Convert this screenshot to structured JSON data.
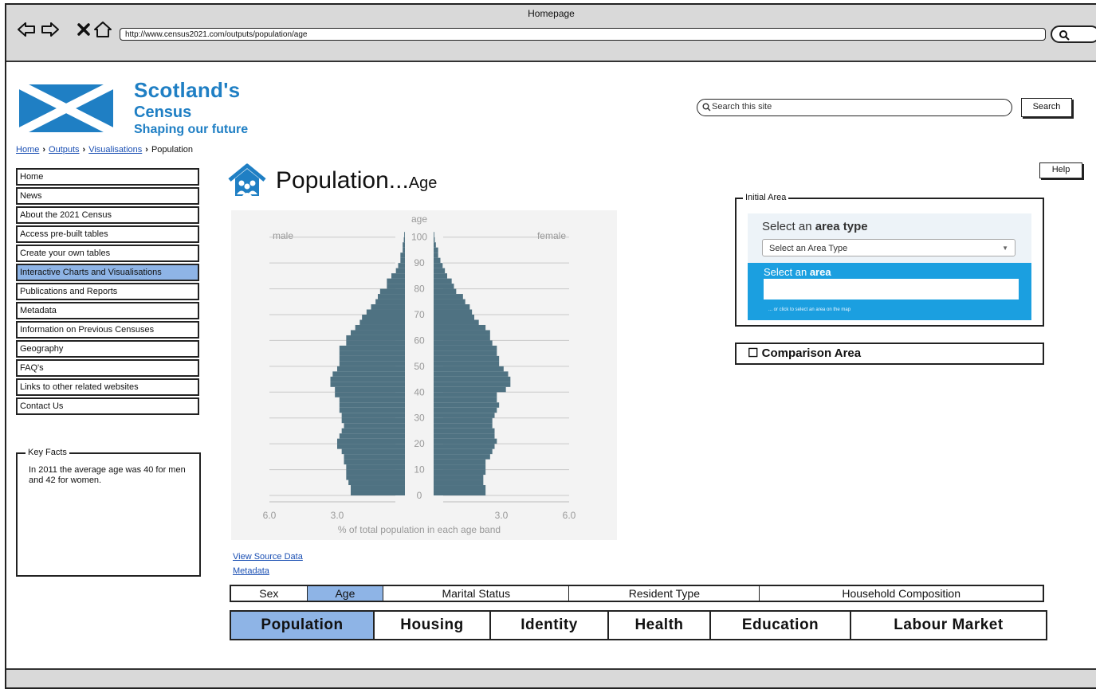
{
  "window": {
    "title": "Homepage",
    "url": "http://www.census2021.com/outputs/population/age"
  },
  "logo": {
    "line1": "Scotland's",
    "line2": "Census",
    "line3": "Shaping our future"
  },
  "breadcrumb": {
    "items": [
      "Home",
      "Outputs",
      "Visualisations"
    ],
    "current": "Population"
  },
  "search": {
    "placeholder": "Search this site",
    "button_label": "Search"
  },
  "help_label": "Help",
  "sidebar": {
    "items": [
      {
        "label": "Home"
      },
      {
        "label": "News"
      },
      {
        "label": "About the 2021 Census"
      },
      {
        "label": "Access pre-built tables"
      },
      {
        "label": "Create your own tables"
      },
      {
        "label": "Interactive Charts and Visualisations",
        "active": true
      },
      {
        "label": "Publications and Reports"
      },
      {
        "label": "Metadata"
      },
      {
        "label": "Information on Previous Censuses"
      },
      {
        "label": "Geography"
      },
      {
        "label": "FAQ's"
      },
      {
        "label": "Links to other related websites"
      },
      {
        "label": "Contact Us"
      }
    ]
  },
  "key_facts": {
    "title": "Key Facts",
    "text": "In 2011 the average age was 40 for men and 42 for women."
  },
  "page": {
    "title": "Population...",
    "subtitle": "Age"
  },
  "chart_data": {
    "type": "bar",
    "orientation": "horizontal-pyramid",
    "title": "",
    "ylabel": "age",
    "xlabel": "% of total population in each age band",
    "left_label": "male",
    "right_label": "female",
    "y_ticks": [
      0,
      10,
      20,
      30,
      40,
      50,
      60,
      70,
      80,
      90,
      100
    ],
    "x_ticks_left": [
      "6.0",
      "3.0"
    ],
    "x_ticks_right": [
      "3.0",
      "6.0"
    ],
    "xlim": [
      0,
      6
    ],
    "ylim": [
      0,
      103
    ],
    "band_width_years": 2,
    "series": [
      {
        "name": "male",
        "color": "#4f7282",
        "values": [
          2.4,
          2.4,
          2.5,
          2.6,
          2.6,
          2.6,
          2.7,
          2.7,
          2.8,
          3.0,
          3.0,
          2.9,
          2.8,
          2.7,
          2.8,
          2.8,
          2.9,
          2.9,
          2.9,
          3.1,
          3.1,
          3.3,
          3.3,
          3.2,
          3.0,
          2.9,
          2.9,
          2.9,
          2.9,
          2.6,
          2.6,
          2.4,
          2.2,
          2.0,
          1.9,
          1.7,
          1.5,
          1.3,
          1.2,
          1.1,
          0.8,
          0.8,
          0.6,
          0.4,
          0.3,
          0.2,
          0.2,
          0.1,
          0.1,
          0.05,
          0.03
        ]
      },
      {
        "name": "female",
        "color": "#4f7282",
        "values": [
          2.3,
          2.3,
          2.2,
          2.2,
          2.3,
          2.3,
          2.3,
          2.5,
          2.6,
          2.7,
          2.8,
          2.7,
          2.7,
          2.6,
          2.6,
          2.7,
          2.8,
          2.9,
          2.8,
          2.8,
          3.2,
          3.4,
          3.4,
          3.3,
          3.1,
          2.9,
          2.9,
          2.8,
          2.8,
          2.6,
          2.5,
          2.5,
          2.3,
          2.0,
          1.8,
          1.7,
          1.6,
          1.4,
          1.3,
          1.0,
          0.9,
          0.8,
          0.6,
          0.5,
          0.4,
          0.3,
          0.2,
          0.2,
          0.1,
          0.05,
          0.03
        ]
      }
    ],
    "grid": true
  },
  "links": {
    "view_source": "View Source Data",
    "metadata": "Metadata"
  },
  "initial_area": {
    "legend": "Initial Area",
    "type_label_pre": "Select an ",
    "type_label_bold": "area type",
    "type_select_value": "Select an Area Type",
    "area_label_pre": "Select an ",
    "area_label_bold": "area",
    "map_hint": "... or click to select an area on the map"
  },
  "comparison": {
    "label": "Comparison Area"
  },
  "sub_tabs": [
    {
      "label": "Sex",
      "active": false
    },
    {
      "label": "Age",
      "active": true
    },
    {
      "label": "Marital Status",
      "active": false
    },
    {
      "label": "Resident Type",
      "active": false
    },
    {
      "label": "Household Composition",
      "active": false
    }
  ],
  "main_tabs": [
    {
      "label": "Population",
      "active": true
    },
    {
      "label": "Housing",
      "active": false
    },
    {
      "label": "Identity",
      "active": false
    },
    {
      "label": "Health",
      "active": false
    },
    {
      "label": "Education",
      "active": false
    },
    {
      "label": "Labour Market",
      "active": false
    }
  ]
}
